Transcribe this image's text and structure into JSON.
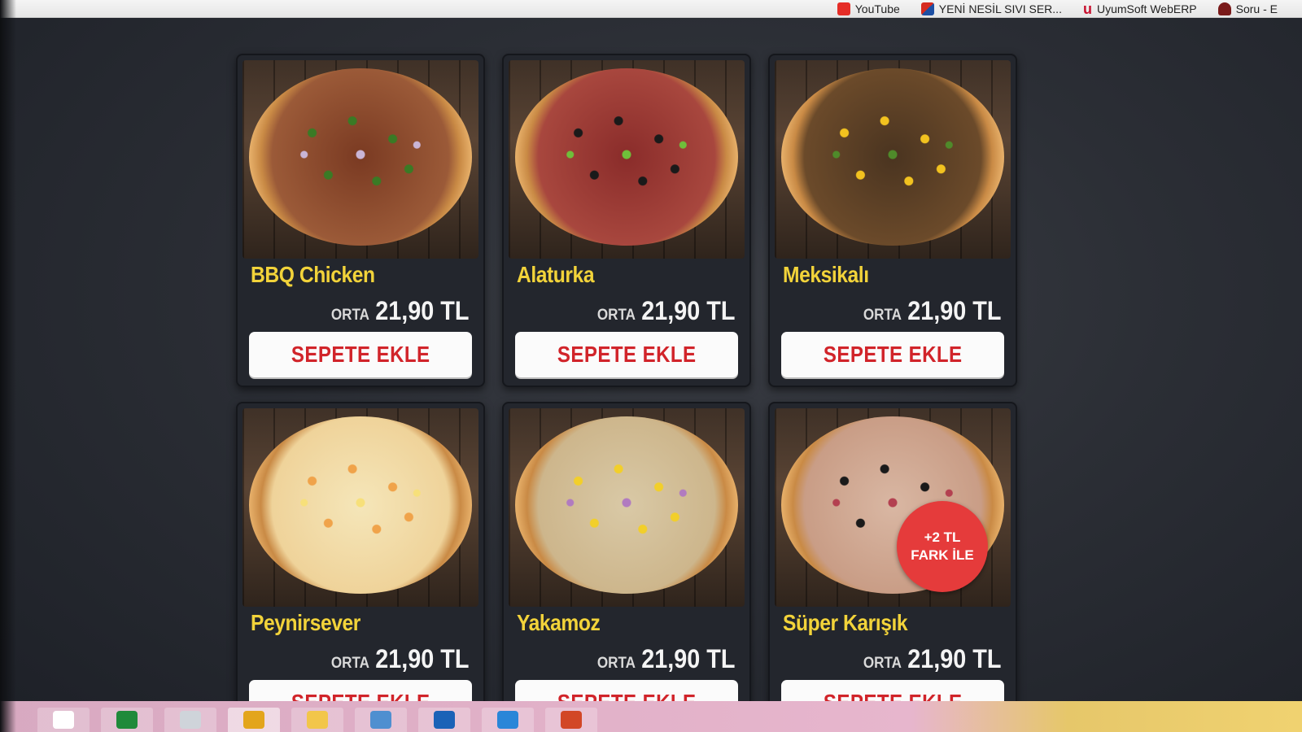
{
  "bookmarks": [
    {
      "label": "YouTube",
      "icon": "youtube-icon"
    },
    {
      "label": "YENİ NESİL SIVI SER...",
      "icon": "yenisivi-icon"
    },
    {
      "label": "UyumSoft WebERP",
      "icon": "uyumsoft-icon"
    },
    {
      "label": "Soru - E",
      "icon": "soru-icon"
    }
  ],
  "products": [
    {
      "name": "BBQ Chicken",
      "size": "ORTA",
      "price": "21,90 TL",
      "button": "SEPETE EKLE",
      "top1": "#7a3a22",
      "top2": "#9b5a38",
      "dot": "#3a7a25",
      "dot2": "#c9b5d6"
    },
    {
      "name": "Alaturka",
      "size": "ORTA",
      "price": "21,90 TL",
      "button": "SEPETE EKLE",
      "top1": "#8a2c2a",
      "top2": "#a8473e",
      "dot": "#1a1a1a",
      "dot2": "#6fbf3a"
    },
    {
      "name": "Meksikalı",
      "size": "ORTA",
      "price": "21,90 TL",
      "button": "SEPETE EKLE",
      "top1": "#4a3420",
      "top2": "#6b4a2a",
      "dot": "#f2c21f",
      "dot2": "#4f8a2a"
    },
    {
      "name": "Peynirsever",
      "size": "ORTA",
      "price": "21,90 TL",
      "button": "SEPETE EKLE",
      "top1": "#f5e6b9",
      "top2": "#efd39a",
      "dot": "#f0a34a",
      "dot2": "#f7e07a"
    },
    {
      "name": "Yakamoz",
      "size": "ORTA",
      "price": "21,90 TL",
      "button": "SEPETE EKLE",
      "top1": "#d9c9a6",
      "top2": "#cdb68c",
      "dot": "#f2cf2a",
      "dot2": "#b17bc0"
    },
    {
      "name": "Süper Karışık",
      "size": "ORTA",
      "price": "21,90 TL",
      "button": "SEPETE EKLE",
      "top1": "#d9b7a3",
      "top2": "#c99d86",
      "dot": "#1a1a1a",
      "dot2": "#b34050",
      "badge": "+2 TL FARK İLE"
    }
  ],
  "taskbar": {
    "items": [
      {
        "icon": "start-icon",
        "color": "#ffffff"
      },
      {
        "icon": "store-icon",
        "color": "#1f8a3a"
      },
      {
        "icon": "mouse-icon",
        "color": "#cfd4da"
      },
      {
        "icon": "chrome-icon",
        "color": "#e3a51c"
      },
      {
        "icon": "folder-icon",
        "color": "#f2c64a"
      },
      {
        "icon": "image-viewer-icon",
        "color": "#4f8fd0"
      },
      {
        "icon": "outlook-icon",
        "color": "#1b62b7"
      },
      {
        "icon": "ie-icon",
        "color": "#2a86d8"
      },
      {
        "icon": "powerpoint-icon",
        "color": "#d24726"
      }
    ]
  }
}
